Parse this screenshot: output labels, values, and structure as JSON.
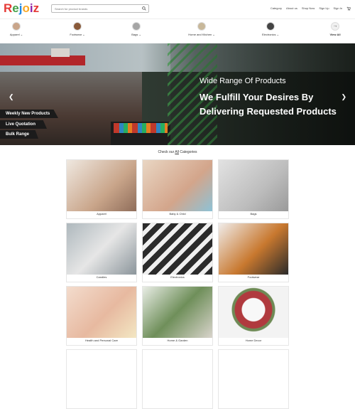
{
  "header": {
    "logo": [
      "R",
      "e",
      "j",
      "o",
      "i",
      "z"
    ],
    "logo_colors": [
      "#e53935",
      "#43a047",
      "#1e88e5",
      "#fdd835",
      "#8e24aa",
      "#e53935"
    ],
    "search_placeholder": "Search for product brands",
    "nav": [
      "Category",
      "About us",
      "Shop Now",
      "Sign Up",
      "Sign In"
    ]
  },
  "categories_bar": [
    {
      "label": "Apparel",
      "color": "#c9a58a"
    },
    {
      "label": "Footwear",
      "color": "#8a5a3a"
    },
    {
      "label": "Bags",
      "color": "#a5a5a5"
    },
    {
      "label": "Home and Kitchen",
      "color": "#c8b89a"
    },
    {
      "label": "Electronics",
      "color": "#444"
    },
    {
      "label": "View All",
      "color": "#ddd"
    }
  ],
  "hero": {
    "subtitle": "Wide Range Of Products",
    "headline": "We Fulfill Your Desires By Delivering Requested Products",
    "tags": [
      "Weekly New Products",
      "Live Quotation",
      "Bulk Range"
    ],
    "prev_icon": "chevron-left-icon",
    "next_icon": "chevron-right-icon"
  },
  "section": {
    "prefix": "Check our",
    "link": "All",
    "suffix": "Categories"
  },
  "tiles": [
    {
      "label": "Apparel",
      "color": "#e9e1d9"
    },
    {
      "label": "Baby & Child",
      "color": "#d7c3ad"
    },
    {
      "label": "Bags",
      "color": "#d9d9d9"
    },
    {
      "label": "Candles",
      "color": "#c2c8cc"
    },
    {
      "label": "Electronics",
      "color": "#ededed"
    },
    {
      "label": "Footwear",
      "color": "#e8e4e1"
    },
    {
      "label": "Health and Personal Care",
      "color": "#ecd3c2"
    },
    {
      "label": "Home & Garden",
      "color": "#dfe4dc"
    },
    {
      "label": "Home Decor",
      "color": "#f3f3f3"
    }
  ]
}
